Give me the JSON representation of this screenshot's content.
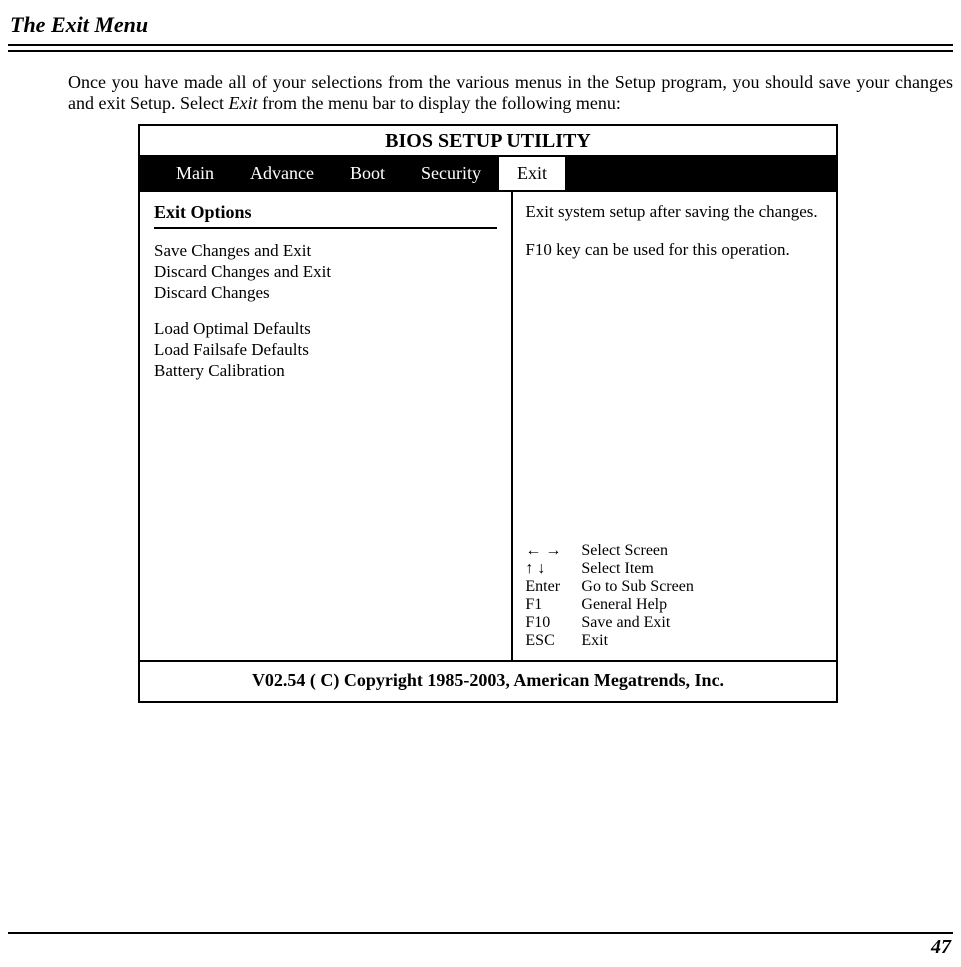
{
  "section_title": "The Exit Menu",
  "intro_pre": "Once you have made all of your selections from the various menus in the Setup program, you should save your changes and exit Setup.  Select ",
  "intro_em": "Exit",
  "intro_post": " from the menu bar to display the following menu:",
  "bios": {
    "title": "BIOS SETUP UTILITY",
    "tabs": {
      "main": "Main",
      "advance": "Advance",
      "boot": "Boot",
      "security": "Security",
      "exit": "Exit"
    },
    "options_title": "Exit Options",
    "options": {
      "o1": "Save Changes and Exit",
      "o2": "Discard Changes and Exit",
      "o3": "Discard Changes",
      "o4": "Load Optimal Defaults",
      "o5": "Load Failsafe Defaults",
      "o6": "Battery Calibration"
    },
    "help1": "Exit system setup after saving the changes.",
    "help2": "F10 key can be used for this operation.",
    "keys": {
      "k1": {
        "label": "",
        "desc": "Select Screen"
      },
      "k2": {
        "label": "",
        "desc": "Select Item"
      },
      "k3": {
        "label": "Enter",
        "desc": "Go to Sub Screen"
      },
      "k4": {
        "label": "F1",
        "desc": "General Help"
      },
      "k5": {
        "label": "F10",
        "desc": "Save and Exit"
      },
      "k6": {
        "label": "ESC",
        "desc": "Exit"
      }
    },
    "footer": "V02.54 ( C) Copyright 1985-2003, American Megatrends, Inc."
  },
  "page_number": "47"
}
